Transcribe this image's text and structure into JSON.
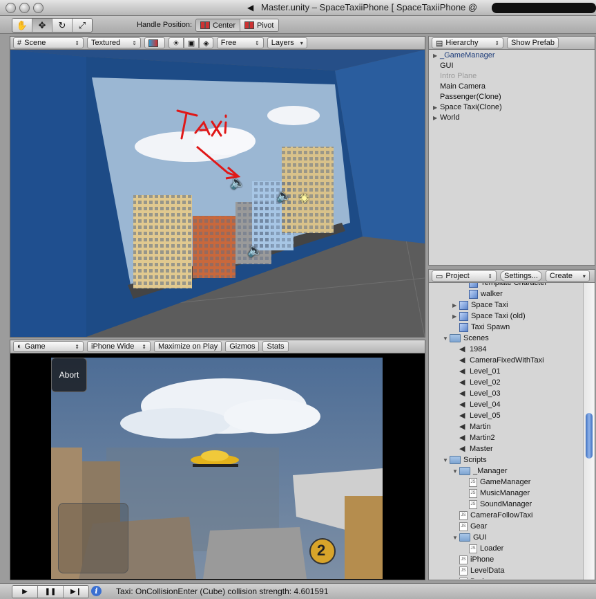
{
  "window": {
    "title": "Master.unity – SpaceTaxiiPhone [ SpaceTaxiiPhone @"
  },
  "toolbar": {
    "tools": [
      "hand-icon",
      "move-icon",
      "rotate-icon",
      "scale-icon"
    ],
    "handle_label": "Handle Position:",
    "center_label": "Center",
    "pivot_label": "Pivot"
  },
  "scene": {
    "mode": "Scene",
    "render_mode": "Textured",
    "camera": "Free",
    "layers": "Layers",
    "annotation": "Taxi"
  },
  "game": {
    "tab": "Game",
    "aspect": "iPhone Wide",
    "maximize": "Maximize on Play",
    "gizmos": "Gizmos",
    "stats": "Stats",
    "abort": "Abort",
    "badge": "2"
  },
  "hierarchy": {
    "menu": "Hierarchy",
    "show_prefab": "Show Prefab",
    "items": [
      {
        "label": "_GameManager",
        "expandable": true,
        "selected": true
      },
      {
        "label": "GUI",
        "expandable": false
      },
      {
        "label": "Intro Plane",
        "expandable": false,
        "disabled": true
      },
      {
        "label": "Main Camera",
        "expandable": false
      },
      {
        "label": "Passenger(Clone)",
        "expandable": false
      },
      {
        "label": "Space Taxi(Clone)",
        "expandable": true
      },
      {
        "label": "World",
        "expandable": true
      }
    ]
  },
  "project": {
    "menu": "Project",
    "settings": "Settings...",
    "create": "Create",
    "items": [
      {
        "label": "Template Character",
        "icon": "cube",
        "indent": 2
      },
      {
        "label": "walker",
        "icon": "cube",
        "indent": 2
      },
      {
        "label": "Space Taxi",
        "icon": "cube",
        "indent": 1,
        "tri": "closed"
      },
      {
        "label": "Space Taxi (old)",
        "icon": "cube",
        "indent": 1,
        "tri": "closed"
      },
      {
        "label": "Taxi Spawn",
        "icon": "cube",
        "indent": 1
      },
      {
        "label": "Scenes",
        "icon": "folder",
        "indent": 0,
        "tri": "open"
      },
      {
        "label": "1984",
        "icon": "scene",
        "indent": 1
      },
      {
        "label": "CameraFixedWithTaxi",
        "icon": "scene",
        "indent": 1
      },
      {
        "label": "Level_01",
        "icon": "scene",
        "indent": 1
      },
      {
        "label": "Level_02",
        "icon": "scene",
        "indent": 1
      },
      {
        "label": "Level_03",
        "icon": "scene",
        "indent": 1
      },
      {
        "label": "Level_04",
        "icon": "scene",
        "indent": 1
      },
      {
        "label": "Level_05",
        "icon": "scene",
        "indent": 1
      },
      {
        "label": "Martin",
        "icon": "scene",
        "indent": 1
      },
      {
        "label": "Martin2",
        "icon": "scene",
        "indent": 1
      },
      {
        "label": "Master",
        "icon": "scene",
        "indent": 1
      },
      {
        "label": "Scripts",
        "icon": "folder",
        "indent": 0,
        "tri": "open"
      },
      {
        "label": "_Manager",
        "icon": "folder",
        "indent": 1,
        "tri": "open"
      },
      {
        "label": "GameManager",
        "icon": "js",
        "indent": 2
      },
      {
        "label": "MusicManager",
        "icon": "js",
        "indent": 2
      },
      {
        "label": "SoundManager",
        "icon": "js",
        "indent": 2
      },
      {
        "label": "CameraFollowTaxi",
        "icon": "js",
        "indent": 1
      },
      {
        "label": "Gear",
        "icon": "js",
        "indent": 1
      },
      {
        "label": "GUI",
        "icon": "folder",
        "indent": 1,
        "tri": "open"
      },
      {
        "label": "Loader",
        "icon": "js",
        "indent": 2
      },
      {
        "label": "iPhone",
        "icon": "js",
        "indent": 1
      },
      {
        "label": "LevelData",
        "icon": "js",
        "indent": 1
      },
      {
        "label": "Pad",
        "icon": "js",
        "indent": 1
      }
    ]
  },
  "status": {
    "message": "Taxi: OnCollisionEnter (Cube) collision strength: 4.601591"
  }
}
